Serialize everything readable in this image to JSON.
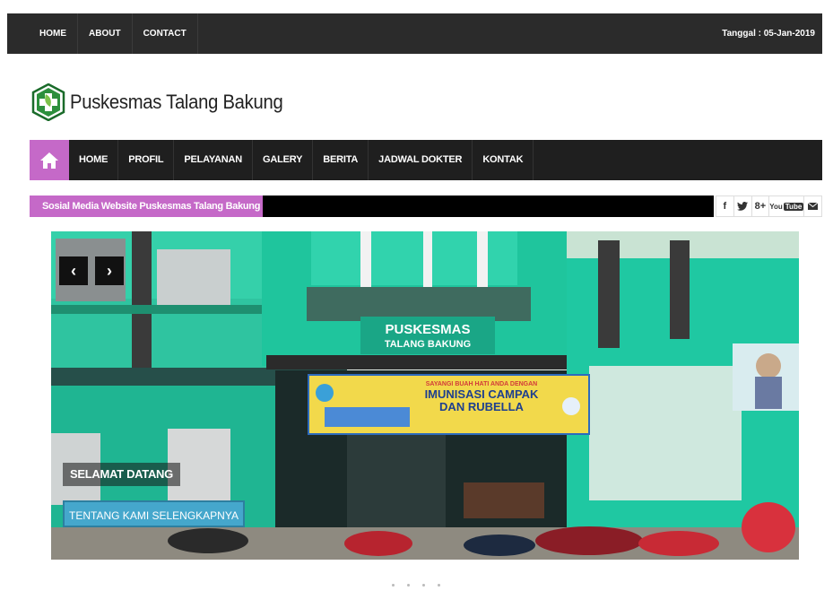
{
  "topbar": {
    "nav": [
      "HOME",
      "ABOUT",
      "CONTACT"
    ],
    "date": "Tanggal : 05-Jan-2019"
  },
  "logo": {
    "text": "Puskesmas Talang Bakung",
    "icon": "cross-leaf-icon"
  },
  "mainnav": {
    "home_icon": "home-icon",
    "items": [
      "HOME",
      "PROFIL",
      "PELAYANAN",
      "GALERY",
      "BERITA",
      "JADWAL DOKTER",
      "KONTAK"
    ]
  },
  "social": {
    "label": "Sosial Media Website Puskesmas Talang Bakung",
    "icons": [
      "facebook-icon",
      "twitter-icon",
      "google-plus-icon",
      "youtube-icon",
      "email-icon"
    ],
    "glyphs": [
      "f",
      "🐦",
      "8+",
      "You",
      "✉"
    ]
  },
  "slider": {
    "prev": "‹",
    "next": "›",
    "building_sign_line1": "PUSKESMAS",
    "building_sign_line2": "TALANG BAKUNG",
    "banner_line1": "SAYANGI BUAH HATI ANDA DENGAN",
    "banner_line2": "IMUNISASI CAMPAK",
    "banner_line3": "DAN RUBELLA",
    "caption_title": "SELAMAT DATANG",
    "caption_button": "TENTANG KAMI SELENGKAPNYA"
  },
  "colors": {
    "accent": "#c569c8",
    "dark": "#1f1f1f",
    "button": "#45a7cc"
  }
}
